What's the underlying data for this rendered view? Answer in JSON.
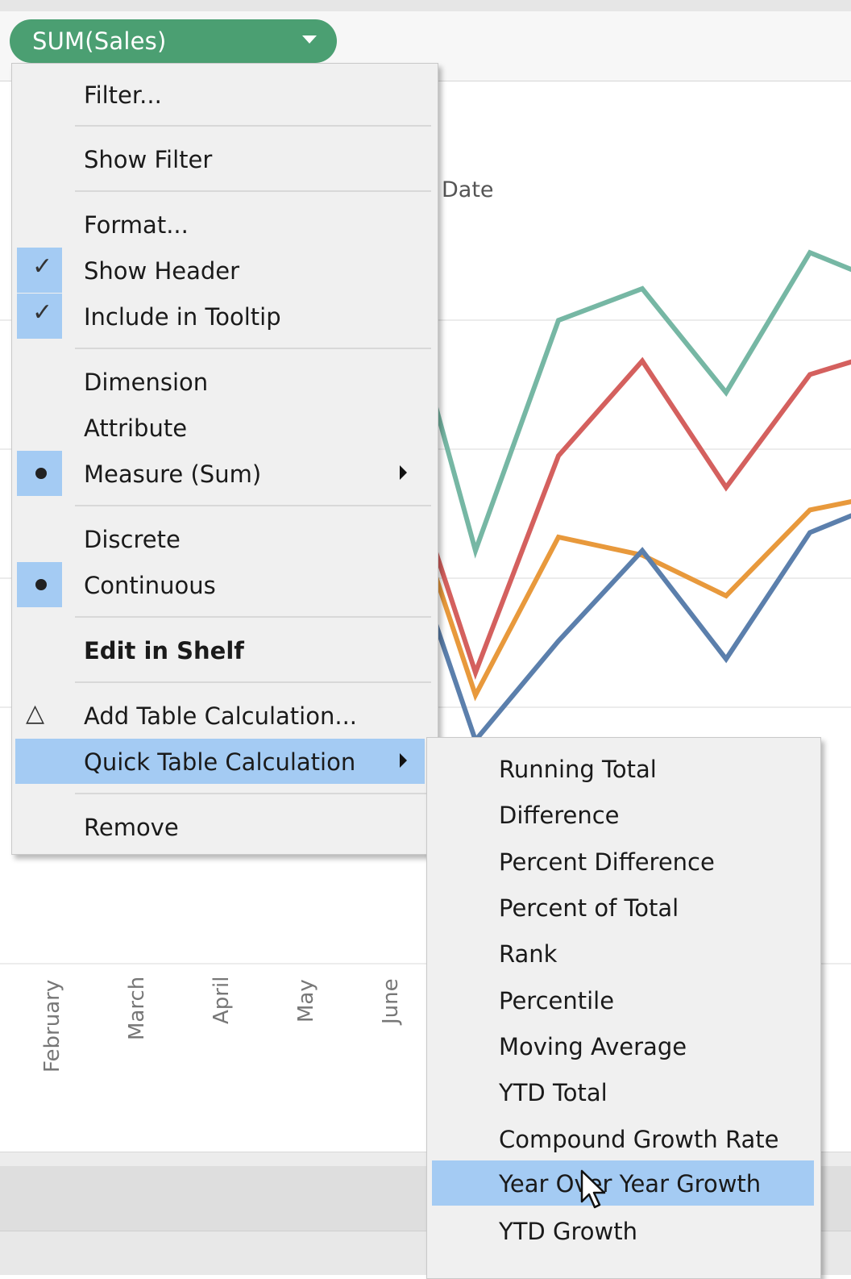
{
  "pill": {
    "label": "SUM(Sales)",
    "color": "#4b9f72"
  },
  "chart": {
    "title_fragment": "Date",
    "months": [
      "February",
      "March",
      "April",
      "May",
      "June"
    ]
  },
  "chart_data": {
    "type": "line",
    "series": [
      {
        "color": "#76b7a4",
        "values": [
          1.0,
          0.32,
          0.83,
          0.9,
          0.67,
          0.98,
          0.94
        ]
      },
      {
        "color": "#d4605e",
        "values": [
          0.62,
          0.05,
          0.53,
          0.74,
          0.46,
          0.71,
          0.74
        ]
      },
      {
        "color": "#e8993c",
        "values": [
          0.56,
          0.0,
          0.35,
          0.31,
          0.22,
          0.41,
          0.43
        ]
      },
      {
        "color": "#5b7fac",
        "values": [
          0.45,
          -0.1,
          0.12,
          0.32,
          0.08,
          0.36,
          0.4
        ]
      }
    ]
  },
  "menu": {
    "items": [
      {
        "label": "Filter..."
      },
      {
        "label": "Show Filter"
      },
      {
        "label": "Format..."
      },
      {
        "label": "Show Header",
        "checked": true
      },
      {
        "label": "Include in Tooltip",
        "checked": true
      },
      {
        "label": "Dimension"
      },
      {
        "label": "Attribute"
      },
      {
        "label": "Measure (Sum)",
        "selected": true,
        "submenu": true
      },
      {
        "label": "Discrete"
      },
      {
        "label": "Continuous",
        "selected": true
      },
      {
        "label": "Edit in Shelf",
        "bold": true
      },
      {
        "label": "Add Table Calculation...",
        "icon": "delta-icon"
      },
      {
        "label": "Quick Table Calculation",
        "highlighted": true,
        "submenu": true
      },
      {
        "label": "Remove"
      }
    ]
  },
  "submenu": {
    "items": [
      {
        "label": "Running Total"
      },
      {
        "label": "Difference"
      },
      {
        "label": "Percent Difference"
      },
      {
        "label": "Percent of Total"
      },
      {
        "label": "Rank"
      },
      {
        "label": "Percentile"
      },
      {
        "label": "Moving Average"
      },
      {
        "label": "YTD Total"
      },
      {
        "label": "Compound Growth Rate"
      },
      {
        "label": "Year Over Year Growth",
        "highlighted": true
      },
      {
        "label": "YTD Growth"
      }
    ]
  },
  "icons": {
    "check": "✓",
    "delta": "△"
  },
  "colors": {
    "highlight": "#a4cbf3",
    "menu_bg": "#f0f0f0"
  }
}
